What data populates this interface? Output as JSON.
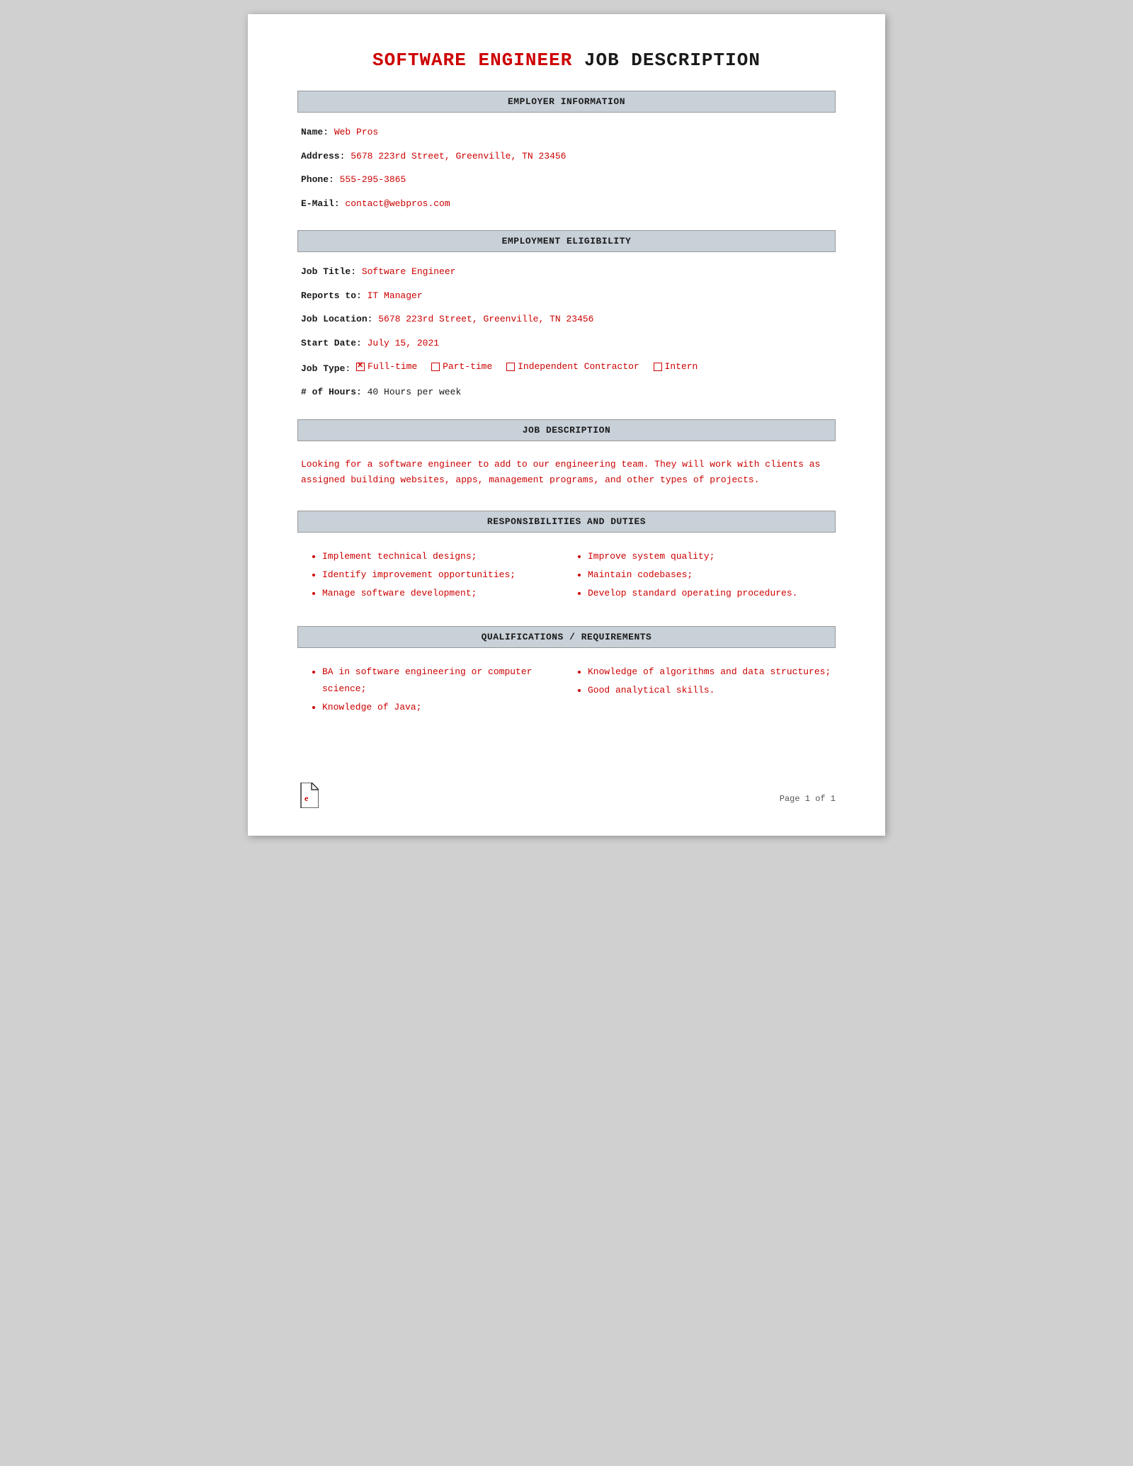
{
  "title": {
    "red_part": "SOFTWARE ENGINEER",
    "black_part": " JOB DESCRIPTION"
  },
  "sections": {
    "employer_info": {
      "header": "EMPLOYER INFORMATION",
      "fields": {
        "name_label": "Name",
        "name_value": "Web Pros",
        "address_label": "Address",
        "address_value": "5678 223rd Street, Greenville, TN 23456",
        "phone_label": "Phone",
        "phone_value": "555-295-3865",
        "email_label": "E-Mail",
        "email_value": "contact@webpros.com"
      }
    },
    "employment_eligibility": {
      "header": "EMPLOYMENT ELIGIBILITY",
      "fields": {
        "job_title_label": "Job Title",
        "job_title_value": "Software Engineer",
        "reports_to_label": "Reports to",
        "reports_to_value": "IT Manager",
        "job_location_label": "Job Location",
        "job_location_value": "5678 223rd Street, Greenville, TN 23456",
        "start_date_label": "Start Date",
        "start_date_value": "July 15, 2021",
        "job_type_label": "Job Type",
        "job_type_options": [
          "Full-time",
          "Part-time",
          "Independent Contractor",
          "Intern"
        ],
        "job_type_checked": [
          true,
          false,
          false,
          false
        ],
        "hours_label": "# of Hours",
        "hours_value": "40 Hours per week"
      }
    },
    "job_description": {
      "header": "JOB DESCRIPTION",
      "text": "Looking for a software engineer to add to our engineering team. They will work with clients as assigned building websites, apps, management programs, and other types of projects."
    },
    "responsibilities": {
      "header": "RESPONSIBILITIES AND DUTIES",
      "left_items": [
        "Implement technical designs;",
        "Identify improvement opportunities;",
        "Manage software development;"
      ],
      "right_items": [
        "Improve system quality;",
        "Maintain codebases;",
        "Develop standard operating procedures."
      ]
    },
    "qualifications": {
      "header": "QUALIFICATIONS / REQUIREMENTS",
      "left_items": [
        "BA in software engineering or computer science;",
        "Knowledge of Java;"
      ],
      "right_items": [
        "Knowledge of algorithms and data structures;",
        "Good analytical skills."
      ]
    }
  },
  "footer": {
    "page_text": "Page 1 of 1"
  }
}
